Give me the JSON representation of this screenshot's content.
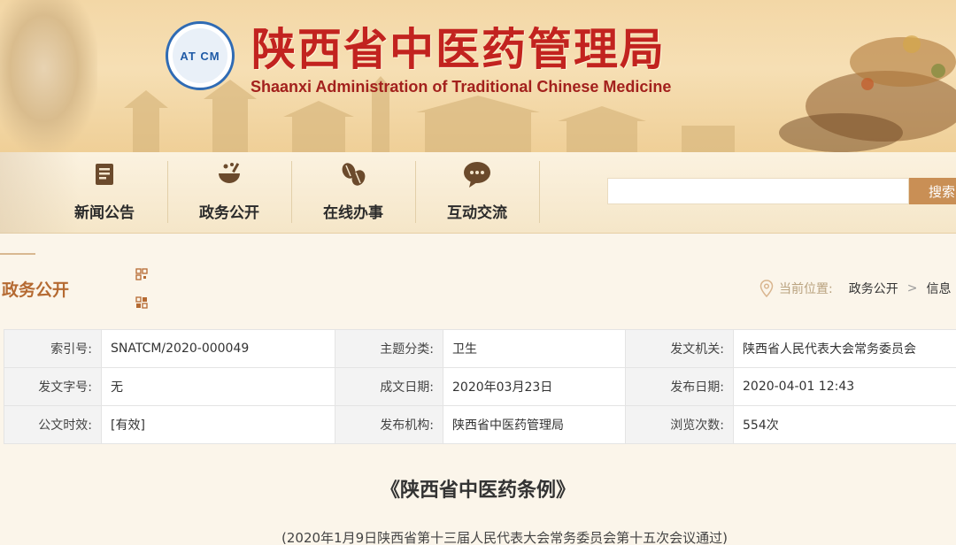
{
  "header": {
    "logo_text": "AT CM",
    "logo_ring_text": "陕西省中医药管理局",
    "title": "陕西省中医药管理局",
    "subtitle": "Shaanxi Administration of Traditional Chinese Medicine"
  },
  "nav": {
    "items": [
      {
        "label": "新闻公告",
        "icon": "document-icon"
      },
      {
        "label": "政务公开",
        "icon": "bowl-icon"
      },
      {
        "label": "在线办事",
        "icon": "leaf-icon"
      },
      {
        "label": "互动交流",
        "icon": "chat-bubble-icon"
      }
    ],
    "search_placeholder": "",
    "search_button": "搜索"
  },
  "section": {
    "title": "政务公开",
    "breadcrumb_prefix": "当前位置:",
    "breadcrumb": [
      "政务公开",
      "信息"
    ]
  },
  "info": {
    "rows": [
      [
        {
          "key": "索引号:",
          "value": "SNATCM/2020-000049"
        },
        {
          "key": "主题分类:",
          "value": "卫生"
        },
        {
          "key": "发文机关:",
          "value": "陕西省人民代表大会常务委员会"
        }
      ],
      [
        {
          "key": "发文字号:",
          "value": "无"
        },
        {
          "key": "成文日期:",
          "value": "2020年03月23日"
        },
        {
          "key": "发布日期:",
          "value": "2020-04-01 12:43"
        }
      ],
      [
        {
          "key": "公文时效:",
          "value": "[有效]"
        },
        {
          "key": "发布机构:",
          "value": "陕西省中医药管理局"
        },
        {
          "key": "浏览次数:",
          "value": "554次"
        }
      ]
    ]
  },
  "document": {
    "title": "《陕西省中医药条例》",
    "subtitle": "(2020年1月9日陕西省第十三届人民代表大会常务委员会第十五次会议通过)"
  },
  "colors": {
    "title_red": "#c2231f",
    "section_orange": "#b56a32",
    "valid_green": "#2f9b2f",
    "search_button": "#c98f55"
  }
}
